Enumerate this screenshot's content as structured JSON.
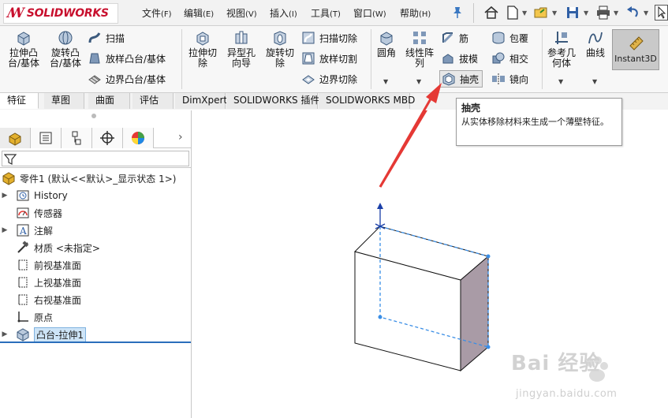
{
  "app": {
    "logo_text": "SOLIDWORKS",
    "menu": [
      {
        "label": "文件",
        "accel": "(F)"
      },
      {
        "label": "编辑",
        "accel": "(E)"
      },
      {
        "label": "视图",
        "accel": "(V)"
      },
      {
        "label": "插入",
        "accel": "(I)"
      },
      {
        "label": "工具",
        "accel": "(T)"
      },
      {
        "label": "窗口",
        "accel": "(W)"
      },
      {
        "label": "帮助",
        "accel": "(H)"
      }
    ]
  },
  "ribbon": {
    "extrude_boss": "拉伸凸台/基体",
    "revolve_boss": "旋转凸台/基体",
    "sweep": "扫描",
    "loft_boss": "放样凸台/基体",
    "boundary_boss": "边界凸台/基体",
    "extrude_cut": "拉伸切除",
    "hole_wizard": "异型孔向导",
    "revolve_cut": "旋转切除",
    "sweep_cut": "扫描切除",
    "loft_cut": "放样切割",
    "boundary_cut": "边界切除",
    "fillet": "圆角",
    "linear_pattern": "线性阵列",
    "rib": "筋",
    "draft": "拔模",
    "shell": "抽壳",
    "wrap": "包覆",
    "intersect": "相交",
    "mirror": "镜向",
    "ref_geometry": "参考几何体",
    "curves": "曲线",
    "instant3d": "Instant3D"
  },
  "tabs": [
    "特征",
    "草图",
    "曲面",
    "评估",
    "DimXpert",
    "SOLIDWORKS 插件",
    "SOLIDWORKS MBD"
  ],
  "tree": {
    "root": "零件1 (默认<<默认>_显示状态 1>)",
    "items": [
      {
        "label": "History",
        "icon": "history-icon",
        "expandable": true
      },
      {
        "label": "传感器",
        "icon": "sensor-icon",
        "expandable": false
      },
      {
        "label": "注解",
        "icon": "annotation-icon",
        "expandable": true
      },
      {
        "label": "材质 <未指定>",
        "icon": "material-icon",
        "expandable": false
      },
      {
        "label": "前视基准面",
        "icon": "plane-icon",
        "expandable": false
      },
      {
        "label": "上视基准面",
        "icon": "plane-icon",
        "expandable": false
      },
      {
        "label": "右视基准面",
        "icon": "plane-icon",
        "expandable": false
      },
      {
        "label": "原点",
        "icon": "origin-icon",
        "expandable": false
      },
      {
        "label": "凸台-拉伸1",
        "icon": "boss-extrude-icon",
        "expandable": true
      }
    ]
  },
  "tooltip": {
    "title": "抽壳",
    "body": "从实体移除材料来生成一个薄壁特征。"
  },
  "watermark": {
    "text": "Bai 经验",
    "url": "jingyan.baidu.com"
  },
  "colors": {
    "brand_red": "#c8102e",
    "selection_blue": "#2a6ebb",
    "arrow_red": "#e53935",
    "box_side": "#a99ba6"
  }
}
